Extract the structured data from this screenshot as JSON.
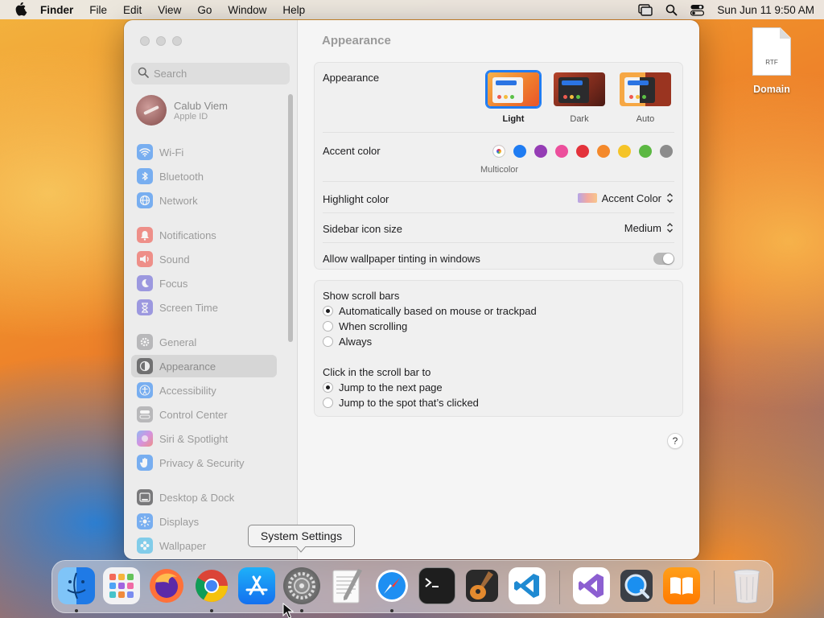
{
  "menubar": {
    "app_name": "Finder",
    "items": [
      "File",
      "Edit",
      "View",
      "Go",
      "Window",
      "Help"
    ],
    "clock": "Sun Jun 11  9:50 AM"
  },
  "desktop": {
    "file": {
      "label": "Domain",
      "ext": "RTF"
    }
  },
  "window": {
    "title": "Appearance",
    "search_placeholder": "Search",
    "account": {
      "name": "Calub Viem",
      "sub": "Apple ID"
    },
    "sidebar": [
      {
        "label": "Wi-Fi",
        "icon": "wifi-icon",
        "color": "#1a7cf5"
      },
      {
        "label": "Bluetooth",
        "icon": "bluetooth-icon",
        "color": "#1a7cf5"
      },
      {
        "label": "Network",
        "icon": "globe-icon",
        "color": "#1a7cf5"
      },
      {
        "label": "Notifications",
        "icon": "bell-icon",
        "color": "#f0443a"
      },
      {
        "label": "Sound",
        "icon": "speaker-icon",
        "color": "#f0443a"
      },
      {
        "label": "Focus",
        "icon": "moon-icon",
        "color": "#5b54d6"
      },
      {
        "label": "Screen Time",
        "icon": "hourglass-icon",
        "color": "#5b54d6"
      },
      {
        "label": "General",
        "icon": "gear-icon",
        "color": "#8e8e93"
      },
      {
        "label": "Appearance",
        "icon": "appearance-icon",
        "color": "#1d1d1f",
        "selected": true
      },
      {
        "label": "Accessibility",
        "icon": "accessibility-icon",
        "color": "#1a7cf5"
      },
      {
        "label": "Control Center",
        "icon": "control-center-icon",
        "color": "#8e8e93"
      },
      {
        "label": "Siri & Spotlight",
        "icon": "siri-icon",
        "color": "#c04bd8"
      },
      {
        "label": "Privacy & Security",
        "icon": "hand-icon",
        "color": "#1a7cf5"
      },
      {
        "label": "Desktop & Dock",
        "icon": "dock-icon",
        "color": "#1d1d1f"
      },
      {
        "label": "Displays",
        "icon": "sun-icon",
        "color": "#1a7cf5"
      },
      {
        "label": "Wallpaper",
        "icon": "wallpaper-icon",
        "color": "#2bb3e8"
      }
    ]
  },
  "appearance": {
    "label": "Appearance",
    "options": [
      {
        "label": "Light",
        "selected": true
      },
      {
        "label": "Dark",
        "selected": false
      },
      {
        "label": "Auto",
        "selected": false
      }
    ],
    "accent": {
      "label": "Accent color",
      "caption": "Multicolor",
      "colors": [
        "#1f7cf2",
        "#953db5",
        "#ec4f9c",
        "#e3323b",
        "#f4892b",
        "#f5c428",
        "#5cb843",
        "#8c8c8c"
      ]
    },
    "highlight": {
      "label": "Highlight color",
      "value": "Accent Color"
    },
    "icon_size": {
      "label": "Sidebar icon size",
      "value": "Medium"
    },
    "tinting": {
      "label": "Allow wallpaper tinting in windows",
      "enabled": false
    }
  },
  "scrollbars": {
    "show_label": "Show scroll bars",
    "show_options": [
      {
        "label": "Automatically based on mouse or trackpad",
        "selected": true
      },
      {
        "label": "When scrolling",
        "selected": false
      },
      {
        "label": "Always",
        "selected": false
      }
    ],
    "click_label": "Click in the scroll bar to",
    "click_options": [
      {
        "label": "Jump to the next page",
        "selected": true
      },
      {
        "label": "Jump to the spot that’s clicked",
        "selected": false
      }
    ]
  },
  "help_label": "?",
  "tooltip": "System Settings",
  "dock": [
    {
      "name": "Finder",
      "icon": "finder-icon",
      "running": true
    },
    {
      "name": "Launchpad",
      "icon": "launchpad-icon",
      "running": false
    },
    {
      "name": "Firefox",
      "icon": "firefox-icon",
      "running": false
    },
    {
      "name": "Google Chrome",
      "icon": "chrome-icon",
      "running": true
    },
    {
      "name": "App Store",
      "icon": "app-store-icon",
      "running": false
    },
    {
      "name": "System Settings",
      "icon": "system-settings-icon",
      "running": true
    },
    {
      "name": "TextEdit",
      "icon": "textedit-icon",
      "running": false
    },
    {
      "name": "Safari",
      "icon": "safari-icon",
      "running": true
    },
    {
      "name": "Terminal",
      "icon": "terminal-icon",
      "running": false
    },
    {
      "name": "GarageBand",
      "icon": "garageband-icon",
      "running": false
    },
    {
      "name": "Visual Studio Code",
      "icon": "vscode-icon",
      "running": false
    },
    {
      "name": "Visual Studio",
      "icon": "visual-studio-icon",
      "running": false
    },
    {
      "name": "QuickTime Player",
      "icon": "quicktime-icon",
      "running": false
    },
    {
      "name": "Books",
      "icon": "books-icon",
      "running": false
    },
    {
      "name": "Trash",
      "icon": "trash-icon",
      "running": false
    }
  ]
}
